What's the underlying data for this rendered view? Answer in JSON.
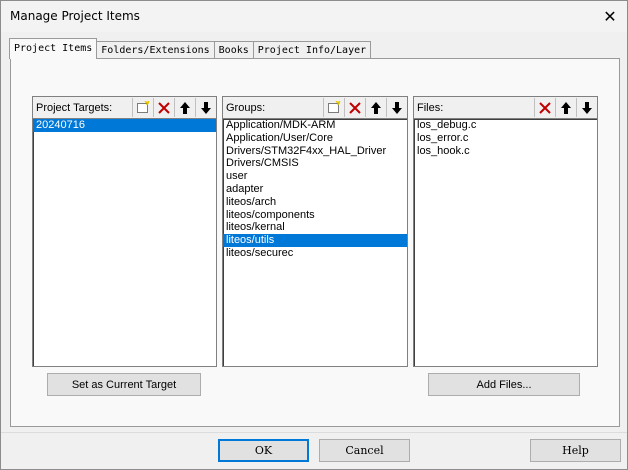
{
  "window": {
    "title": "Manage Project Items",
    "close_glyph": "✕"
  },
  "tabs": [
    {
      "label": "Project Items",
      "active": true
    },
    {
      "label": "Folders/Extensions",
      "active": false
    },
    {
      "label": "Books",
      "active": false
    },
    {
      "label": "Project Info/Layer",
      "active": false
    }
  ],
  "targets": {
    "header": "Project Targets:",
    "items": [
      "20240716"
    ],
    "selected_index": 0,
    "set_current_label": "Set as Current Target"
  },
  "groups": {
    "header": "Groups:",
    "items": [
      "Application/MDK-ARM",
      "Application/User/Core",
      "Drivers/STM32F4xx_HAL_Driver",
      "Drivers/CMSIS",
      "user",
      "adapter",
      "liteos/arch",
      "liteos/components",
      "liteos/kernal",
      "liteos/utils",
      "liteos/securec"
    ],
    "selected_index": 9
  },
  "files": {
    "header": "Files:",
    "items": [
      "los_debug.c",
      "los_error.c",
      "los_hook.c"
    ],
    "add_files_label": "Add Files..."
  },
  "buttons": {
    "ok": "OK",
    "cancel": "Cancel",
    "help": "Help"
  },
  "colors": {
    "selection": "#0078d7",
    "delete_red": "#c00000",
    "new_icon_yellow": "#e8c800"
  }
}
